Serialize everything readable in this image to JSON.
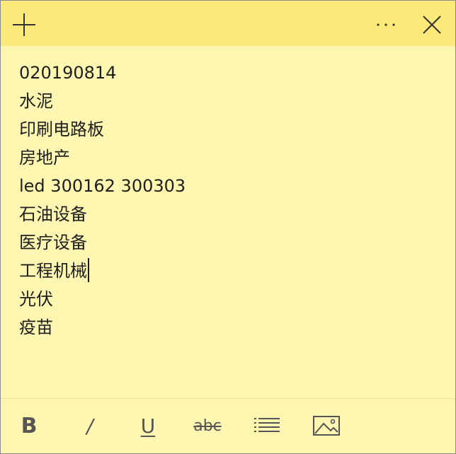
{
  "note": {
    "lines": [
      "020190814",
      "水泥",
      "印刷电路板",
      "房地产",
      "led 300162 300303",
      "石油设备",
      "医疗设备",
      "工程机械",
      "光伏",
      "疫苗"
    ]
  },
  "titlebar": {
    "icons": [
      "plus-icon",
      "more-icon",
      "close-icon"
    ],
    "background": "#fde97a"
  },
  "toolbar": {
    "bold_label": "B",
    "italic_label": "/",
    "underline_label": "U",
    "strike_label": "abc",
    "icons": [
      "bullet-list-icon",
      "image-icon"
    ]
  },
  "colors": {
    "note_background": "#fff7b1",
    "titlebar": "#fde97a",
    "text": "#1e1e1e"
  }
}
